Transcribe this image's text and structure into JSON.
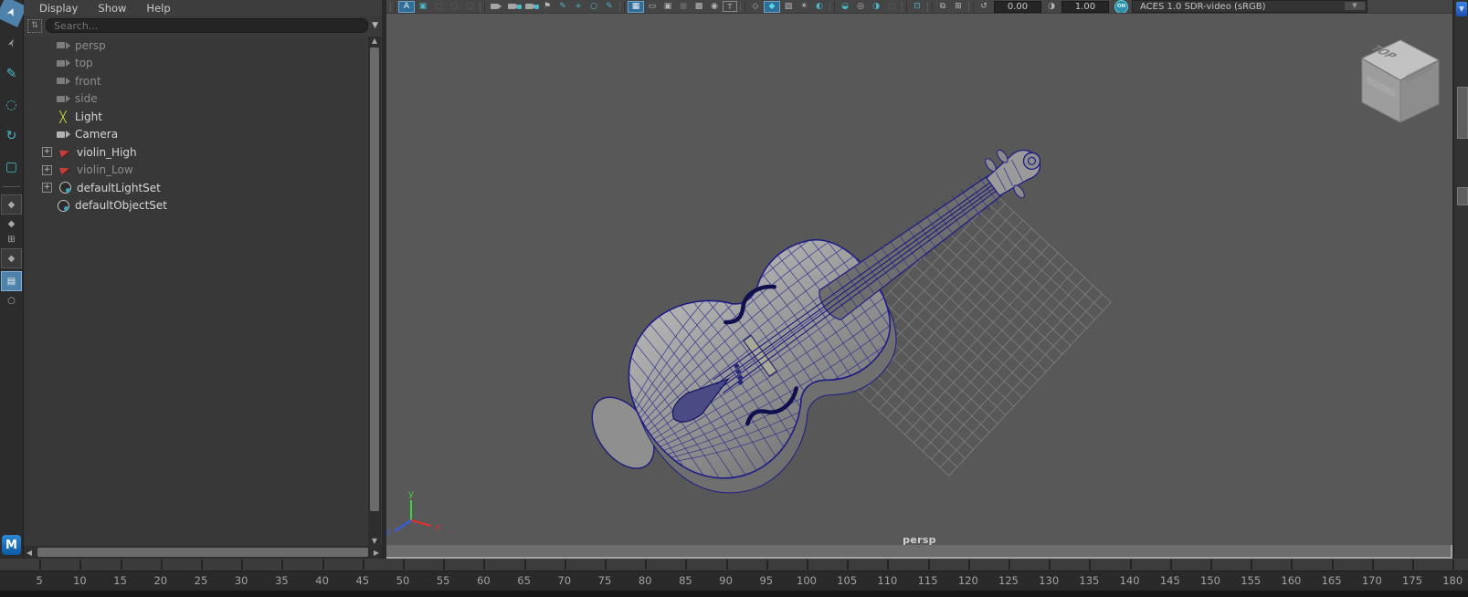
{
  "left_toolbar": {
    "tools": [
      {
        "name": "select-tool",
        "glyph": "➤",
        "active": true
      },
      {
        "name": "lasso-select-tool",
        "glyph": "➣",
        "active": false
      },
      {
        "name": "paint-select-tool",
        "glyph": "✎",
        "active": false,
        "teal": true
      },
      {
        "name": "move-tool",
        "glyph": "◌",
        "active": false,
        "teal": true
      },
      {
        "name": "rotate-tool",
        "glyph": "↻",
        "active": false,
        "teal": true
      },
      {
        "name": "scale-tool",
        "glyph": "▢",
        "active": false,
        "teal": true
      }
    ],
    "layouts": [
      {
        "name": "layout-single-pane",
        "glyph": "◆",
        "mini": false
      },
      {
        "name": "layout-two-pane",
        "glyph": "◆",
        "mini": true
      },
      {
        "name": "layout-four-pane",
        "glyph": "⊞",
        "mini": true
      },
      {
        "name": "layout-persp-outliner",
        "glyph": "◆",
        "mini": false
      },
      {
        "name": "layout-outliner-active",
        "glyph": "▤",
        "mini": false,
        "active": true
      },
      {
        "name": "zoom-layout",
        "glyph": "○",
        "mini": true
      }
    ],
    "logo": "M"
  },
  "outliner": {
    "menu": [
      "Display",
      "Show",
      "Help"
    ],
    "search_placeholder": "Search...",
    "filter_glyph": "⇅",
    "items": [
      {
        "label": "persp",
        "icon": "camera",
        "dim": true,
        "expand": false
      },
      {
        "label": "top",
        "icon": "camera",
        "dim": true,
        "expand": false
      },
      {
        "label": "front",
        "icon": "camera",
        "dim": true,
        "expand": false
      },
      {
        "label": "side",
        "icon": "camera",
        "dim": true,
        "expand": false
      },
      {
        "label": "Light",
        "icon": "light",
        "dim": false,
        "expand": false
      },
      {
        "label": "Camera",
        "icon": "camera",
        "dim": false,
        "expand": false
      },
      {
        "label": "violin_High",
        "icon": "mesh",
        "dim": false,
        "expand": true
      },
      {
        "label": "violin_Low",
        "icon": "mesh",
        "dim": true,
        "expand": true
      },
      {
        "label": "defaultLightSet",
        "icon": "set",
        "dim": false,
        "expand": true
      },
      {
        "label": "defaultObjectSet",
        "icon": "set",
        "dim": false,
        "expand": false
      }
    ]
  },
  "viewport": {
    "toolbar": {
      "items": [
        {
          "name": "panel-grip",
          "kind": "sep"
        },
        {
          "name": "absolute-view-button",
          "glyph": "A",
          "kind": "active"
        },
        {
          "name": "highlight-selection-icon",
          "glyph": "▣",
          "kind": "teal"
        },
        {
          "name": "history-icon",
          "glyph": "▢",
          "kind": "dim"
        },
        {
          "name": "cache-icon",
          "glyph": "▢",
          "kind": "dim"
        },
        {
          "name": "playblast-icon",
          "glyph": "▢",
          "kind": "dim"
        },
        {
          "name": "divider",
          "kind": "sep"
        },
        {
          "name": "select-camera-icon",
          "kind": "cam"
        },
        {
          "name": "lock-camera-icon",
          "kind": "camdot"
        },
        {
          "name": "camera-attributes-icon",
          "kind": "camdot"
        },
        {
          "name": "bookmark-icon",
          "glyph": "⚑",
          "kind": "icon"
        },
        {
          "name": "image-plane-icon",
          "glyph": "✎",
          "kind": "teal"
        },
        {
          "name": "2d-pan-zoom-icon",
          "glyph": "+",
          "kind": "teal"
        },
        {
          "name": "zoom-region-icon",
          "glyph": "○",
          "kind": "teal"
        },
        {
          "name": "grease-pencil-icon",
          "glyph": "✎",
          "kind": "teal"
        },
        {
          "name": "divider",
          "kind": "sep"
        },
        {
          "name": "grid-icon",
          "glyph": "▦",
          "kind": "active"
        },
        {
          "name": "film-gate-icon",
          "glyph": "▭",
          "kind": "icon"
        },
        {
          "name": "resolution-gate-icon",
          "glyph": "▣",
          "kind": "icon"
        },
        {
          "name": "gate-mask-icon",
          "glyph": "■",
          "kind": "dim"
        },
        {
          "name": "field-chart-icon",
          "glyph": "▩",
          "kind": "icon"
        },
        {
          "name": "safe-action-icon",
          "glyph": "◉",
          "kind": "icon"
        },
        {
          "name": "safe-title-icon",
          "glyph": "T",
          "kind": "boxed"
        },
        {
          "name": "divider",
          "kind": "sep"
        },
        {
          "name": "wireframe-icon",
          "glyph": "◇",
          "kind": "icon"
        },
        {
          "name": "shaded-icon",
          "glyph": "◆",
          "kind": "activeteal"
        },
        {
          "name": "textured-icon",
          "glyph": "▨",
          "kind": "icon"
        },
        {
          "name": "use-all-lights-icon",
          "glyph": "☀",
          "kind": "icon"
        },
        {
          "name": "shadows-icon",
          "glyph": "◐",
          "kind": "teal"
        },
        {
          "name": "divider",
          "kind": "sep"
        },
        {
          "name": "ambient-occlusion-icon",
          "glyph": "◒",
          "kind": "teal"
        },
        {
          "name": "motion-blur-icon",
          "glyph": "◎",
          "kind": "icon"
        },
        {
          "name": "depth-of-field-icon",
          "glyph": "◑",
          "kind": "teal"
        },
        {
          "name": "isolate-select-icon",
          "glyph": "▢",
          "kind": "dim"
        },
        {
          "name": "divider",
          "kind": "sep"
        },
        {
          "name": "select-objects-icon",
          "glyph": "⊡",
          "kind": "teal"
        },
        {
          "name": "divider",
          "kind": "sep"
        },
        {
          "name": "xray-icon",
          "glyph": "⧉",
          "kind": "icon"
        },
        {
          "name": "xray-joints-icon",
          "glyph": "⊞",
          "kind": "icon"
        },
        {
          "name": "divider",
          "kind": "sep"
        },
        {
          "name": "exposure-icon",
          "glyph": "↺",
          "kind": "icon"
        }
      ],
      "exposure_value": "0.00",
      "gamma_icon": "◑",
      "gamma_value": "1.00",
      "on_badge": "ON",
      "view_transform": "ACES 1.0 SDR-video (sRGB)",
      "dropdown_glyph": "▼"
    },
    "camera_label": "persp",
    "view_cube": {
      "top_label": "TOP"
    },
    "axis": {
      "x": "x",
      "y": "y",
      "z": "z"
    }
  },
  "timeline": {
    "frames": [
      5,
      10,
      15,
      20,
      25,
      30,
      35,
      40,
      45,
      50,
      55,
      60,
      65,
      70,
      75,
      80,
      85,
      90,
      95,
      100,
      105,
      110,
      115,
      120,
      125,
      130,
      135,
      140,
      145,
      150,
      155,
      160,
      165,
      170,
      175,
      180
    ]
  },
  "colors": {
    "viewport_bg": "#585858",
    "wireframe": "#22228c",
    "accent_blue": "#4f82ab",
    "teal": "#49b8c8",
    "grid_line": "#8a8a8a"
  }
}
